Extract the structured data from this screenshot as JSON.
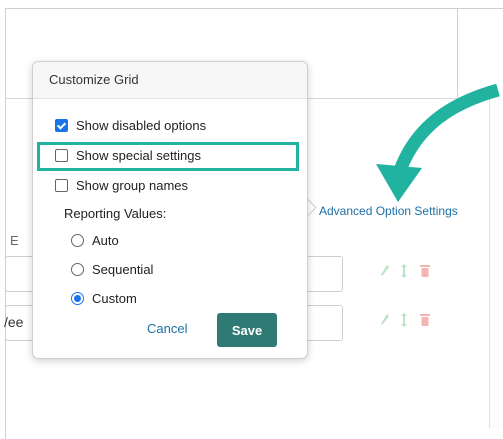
{
  "popover": {
    "title": "Customize Grid",
    "options": [
      {
        "label": "Show disabled options",
        "checked": true
      },
      {
        "label": "Show special settings",
        "checked": false
      },
      {
        "label": "Show group names",
        "checked": false
      }
    ],
    "reporting_label": "Reporting Values:",
    "reporting_options": [
      {
        "label": "Auto",
        "selected": false
      },
      {
        "label": "Sequential",
        "selected": false
      },
      {
        "label": "Custom",
        "selected": true
      }
    ],
    "cancel_label": "Cancel",
    "save_label": "Save"
  },
  "background": {
    "column_letter": "E",
    "row2_partial_text": "/ee",
    "advanced_link": "Advanced Option Settings"
  },
  "colors": {
    "highlight": "#22b3a0",
    "save_button": "#2f7a74",
    "link": "#1d6fa5",
    "checkbox_accent": "#1a73e8",
    "delete_icon": "#f3b5b0",
    "action_icons": "#b9e3c6"
  },
  "icons": [
    "pencil-icon",
    "sort-icon",
    "trash-icon",
    "curved-arrow-icon"
  ]
}
